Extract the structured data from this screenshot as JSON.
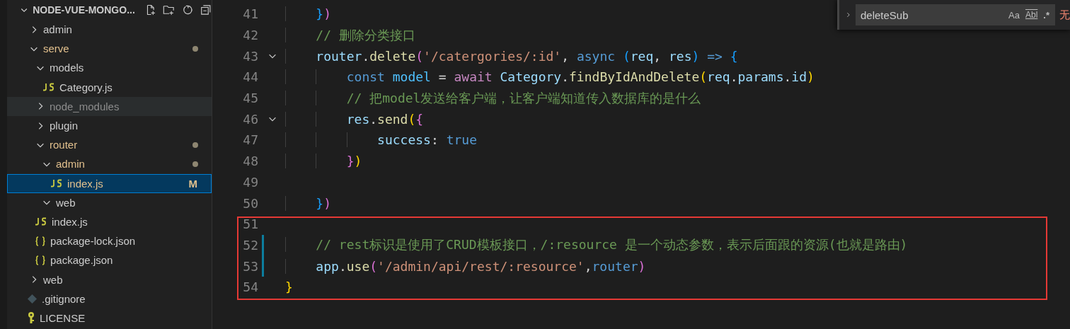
{
  "explorer": {
    "title": "NODE-VUE-MONGO...",
    "expanded": true,
    "tree": [
      {
        "label": "admin",
        "kind": "folder",
        "expanded": false,
        "modified": false,
        "selected": false,
        "hovered": false,
        "dimmed": false
      },
      {
        "label": "serve",
        "kind": "folder",
        "expanded": true,
        "modified": true,
        "selected": false,
        "hovered": false,
        "dimmed": false,
        "children": [
          {
            "label": "models",
            "kind": "folder",
            "expanded": true,
            "modified": false,
            "selected": false,
            "hovered": false,
            "dimmed": false,
            "children": [
              {
                "label": "Category.js",
                "kind": "js",
                "modified": false,
                "selected": false,
                "hovered": false,
                "dimmed": false
              }
            ]
          },
          {
            "label": "node_modules",
            "kind": "folder",
            "expanded": false,
            "modified": false,
            "selected": false,
            "hovered": true,
            "dimmed": true
          },
          {
            "label": "plugin",
            "kind": "folder",
            "expanded": false,
            "modified": false,
            "selected": false,
            "hovered": false,
            "dimmed": false
          },
          {
            "label": "router",
            "kind": "folder",
            "expanded": true,
            "modified": true,
            "selected": false,
            "hovered": false,
            "dimmed": false,
            "children": [
              {
                "label": "admin",
                "kind": "folder",
                "expanded": true,
                "modified": true,
                "selected": false,
                "hovered": false,
                "dimmed": false,
                "children": [
                  {
                    "label": "index.js",
                    "kind": "js",
                    "modified": true,
                    "badge": "M",
                    "selected": true,
                    "hovered": false,
                    "dimmed": false
                  }
                ]
              },
              {
                "label": "web",
                "kind": "folder",
                "expanded": true,
                "modified": false,
                "selected": false,
                "hovered": false,
                "dimmed": false
              }
            ]
          },
          {
            "label": "index.js",
            "kind": "js",
            "modified": false,
            "selected": false,
            "hovered": false,
            "dimmed": false
          },
          {
            "label": "package-lock.json",
            "kind": "json",
            "modified": false,
            "selected": false,
            "hovered": false,
            "dimmed": false
          },
          {
            "label": "package.json",
            "kind": "json",
            "modified": false,
            "selected": false,
            "hovered": false,
            "dimmed": false
          }
        ]
      },
      {
        "label": "web",
        "kind": "folder",
        "expanded": false,
        "modified": false,
        "selected": false,
        "hovered": false,
        "dimmed": false
      },
      {
        "label": ".gitignore",
        "kind": "git",
        "modified": false,
        "selected": false,
        "hovered": false,
        "dimmed": false
      },
      {
        "label": "LICENSE",
        "kind": "license",
        "modified": false,
        "selected": false,
        "hovered": false,
        "dimmed": false
      }
    ]
  },
  "find_widget": {
    "expanded": false,
    "value": "deleteSub",
    "options": [
      "Aa",
      "Abl",
      ".*"
    ],
    "result": "无"
  },
  "editor": {
    "lines": [
      {
        "number": "41",
        "foldable": false,
        "changed": false,
        "tokens": [
          {
            "text": "    }",
            "kind": "b3"
          },
          {
            "text": ")",
            "kind": "b2"
          }
        ]
      },
      {
        "number": "42",
        "foldable": false,
        "changed": false,
        "tokens": [
          {
            "text": "    // 删除分类接口",
            "kind": "c"
          }
        ]
      },
      {
        "number": "43",
        "foldable": true,
        "changed": false,
        "tokens": [
          {
            "text": "    router",
            "kind": "v"
          },
          {
            "text": ".",
            "kind": "p"
          },
          {
            "text": "delete",
            "kind": "f"
          },
          {
            "text": "(",
            "kind": "b2"
          },
          {
            "text": "'/catergories/:id'",
            "kind": "s"
          },
          {
            "text": ", ",
            "kind": "p"
          },
          {
            "text": "async ",
            "kind": "k"
          },
          {
            "text": "(",
            "kind": "b3"
          },
          {
            "text": "req",
            "kind": "v"
          },
          {
            "text": ", ",
            "kind": "p"
          },
          {
            "text": "res",
            "kind": "v"
          },
          {
            "text": ")",
            "kind": "b3"
          },
          {
            "text": " => ",
            "kind": "k"
          },
          {
            "text": "{",
            "kind": "b3"
          }
        ]
      },
      {
        "number": "44",
        "foldable": false,
        "changed": false,
        "tokens": [
          {
            "text": "        const ",
            "kind": "k"
          },
          {
            "text": "model",
            "kind": "cv"
          },
          {
            "text": " = ",
            "kind": "p"
          },
          {
            "text": "await ",
            "kind": "ctl"
          },
          {
            "text": "Category",
            "kind": "v"
          },
          {
            "text": ".",
            "kind": "p"
          },
          {
            "text": "findByIdAndDelete",
            "kind": "f"
          },
          {
            "text": "(",
            "kind": "b1"
          },
          {
            "text": "req",
            "kind": "v"
          },
          {
            "text": ".",
            "kind": "p"
          },
          {
            "text": "params",
            "kind": "v"
          },
          {
            "text": ".",
            "kind": "p"
          },
          {
            "text": "id",
            "kind": "v"
          },
          {
            "text": ")",
            "kind": "b1"
          }
        ]
      },
      {
        "number": "45",
        "foldable": false,
        "changed": false,
        "tokens": [
          {
            "text": "        // 把model发送给客户端，让客户端知道传入数据库的是什么",
            "kind": "c"
          }
        ]
      },
      {
        "number": "46",
        "foldable": true,
        "changed": false,
        "tokens": [
          {
            "text": "        res",
            "kind": "v"
          },
          {
            "text": ".",
            "kind": "p"
          },
          {
            "text": "send",
            "kind": "f"
          },
          {
            "text": "(",
            "kind": "b1"
          },
          {
            "text": "{",
            "kind": "b2"
          }
        ]
      },
      {
        "number": "47",
        "foldable": false,
        "changed": false,
        "tokens": [
          {
            "text": "            success",
            "kind": "v"
          },
          {
            "text": ": ",
            "kind": "p"
          },
          {
            "text": "true",
            "kind": "k"
          }
        ]
      },
      {
        "number": "48",
        "foldable": false,
        "changed": false,
        "tokens": [
          {
            "text": "        }",
            "kind": "b2"
          },
          {
            "text": ")",
            "kind": "b1"
          }
        ]
      },
      {
        "number": "49",
        "foldable": false,
        "changed": false
      },
      {
        "number": "50",
        "foldable": false,
        "changed": false,
        "tokens": [
          {
            "text": "    }",
            "kind": "b3"
          },
          {
            "text": ")",
            "kind": "b2"
          }
        ]
      },
      {
        "number": "51",
        "foldable": false,
        "changed": false
      },
      {
        "number": "52",
        "foldable": false,
        "changed": true,
        "tokens": [
          {
            "text": "    // rest标识是使用了CRUD模板接口，/:resource 是一个动态参数，表示后面跟的资源(也就是路由)",
            "kind": "c"
          }
        ]
      },
      {
        "number": "53",
        "foldable": false,
        "changed": true,
        "tokens": [
          {
            "text": "    app",
            "kind": "v"
          },
          {
            "text": ".",
            "kind": "p"
          },
          {
            "text": "use",
            "kind": "f"
          },
          {
            "text": "(",
            "kind": "b2"
          },
          {
            "text": "'/admin/api/rest/:resource'",
            "kind": "s"
          },
          {
            "text": ",",
            "kind": "p"
          },
          {
            "text": "router",
            "kind": "k"
          },
          {
            "text": ")",
            "kind": "b2"
          }
        ]
      },
      {
        "number": "54",
        "foldable": false,
        "changed": false,
        "tokens": [
          {
            "text": "}",
            "kind": "b1"
          }
        ]
      }
    ],
    "highlight": {
      "shown": true
    }
  }
}
